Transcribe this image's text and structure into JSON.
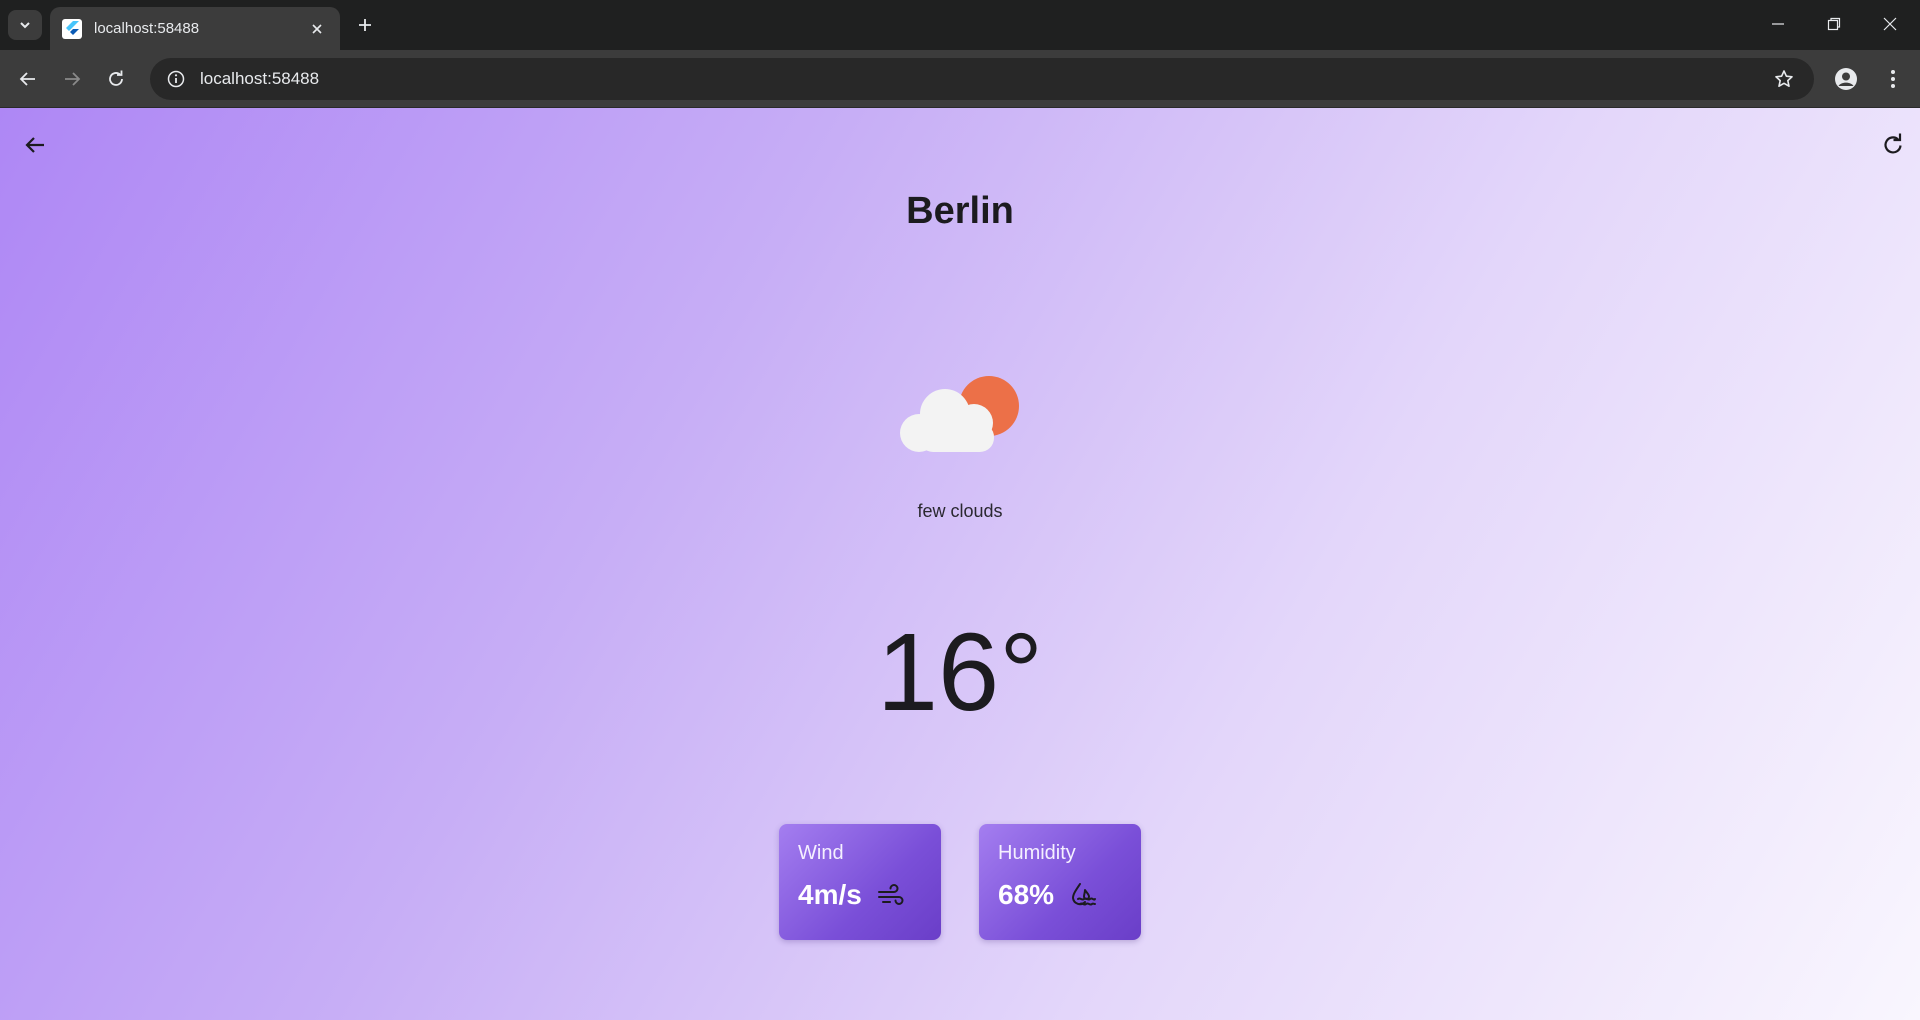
{
  "browser": {
    "tab_title": "localhost:58488",
    "url": "localhost:58488"
  },
  "page": {
    "city": "Berlin",
    "condition": "few clouds",
    "condition_icon": "sun-behind-cloud",
    "temperature": "16°",
    "cards": [
      {
        "label": "Wind",
        "value": "4m/s",
        "icon": "wind-icon"
      },
      {
        "label": "Humidity",
        "value": "68%",
        "icon": "humidity-icon"
      }
    ]
  },
  "colors": {
    "gradient_start": "#ae87f5",
    "gradient_end": "#f9f6fe",
    "card": "#7a4fd8",
    "sun": "#ec7048",
    "cloud": "#f3f3f3"
  }
}
